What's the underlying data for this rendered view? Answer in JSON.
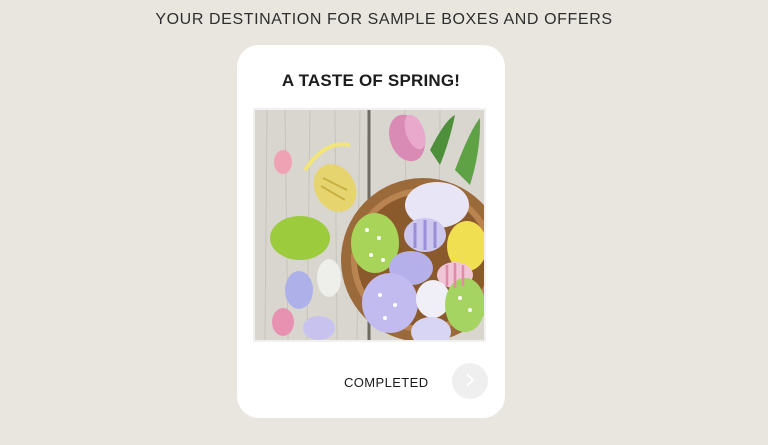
{
  "header": {
    "tagline": "YOUR DESTINATION FOR SAMPLE BOXES AND OFFERS"
  },
  "offer_card": {
    "title": "A TASTE OF SPRING!",
    "image_alt": "Easter eggs in a basket with tulips",
    "status_label": "COMPLETED",
    "next_icon": "chevron-right-icon"
  },
  "colors": {
    "page_background": "#e9e6e0",
    "card_background": "#ffffff",
    "button_background": "#efefef"
  }
}
